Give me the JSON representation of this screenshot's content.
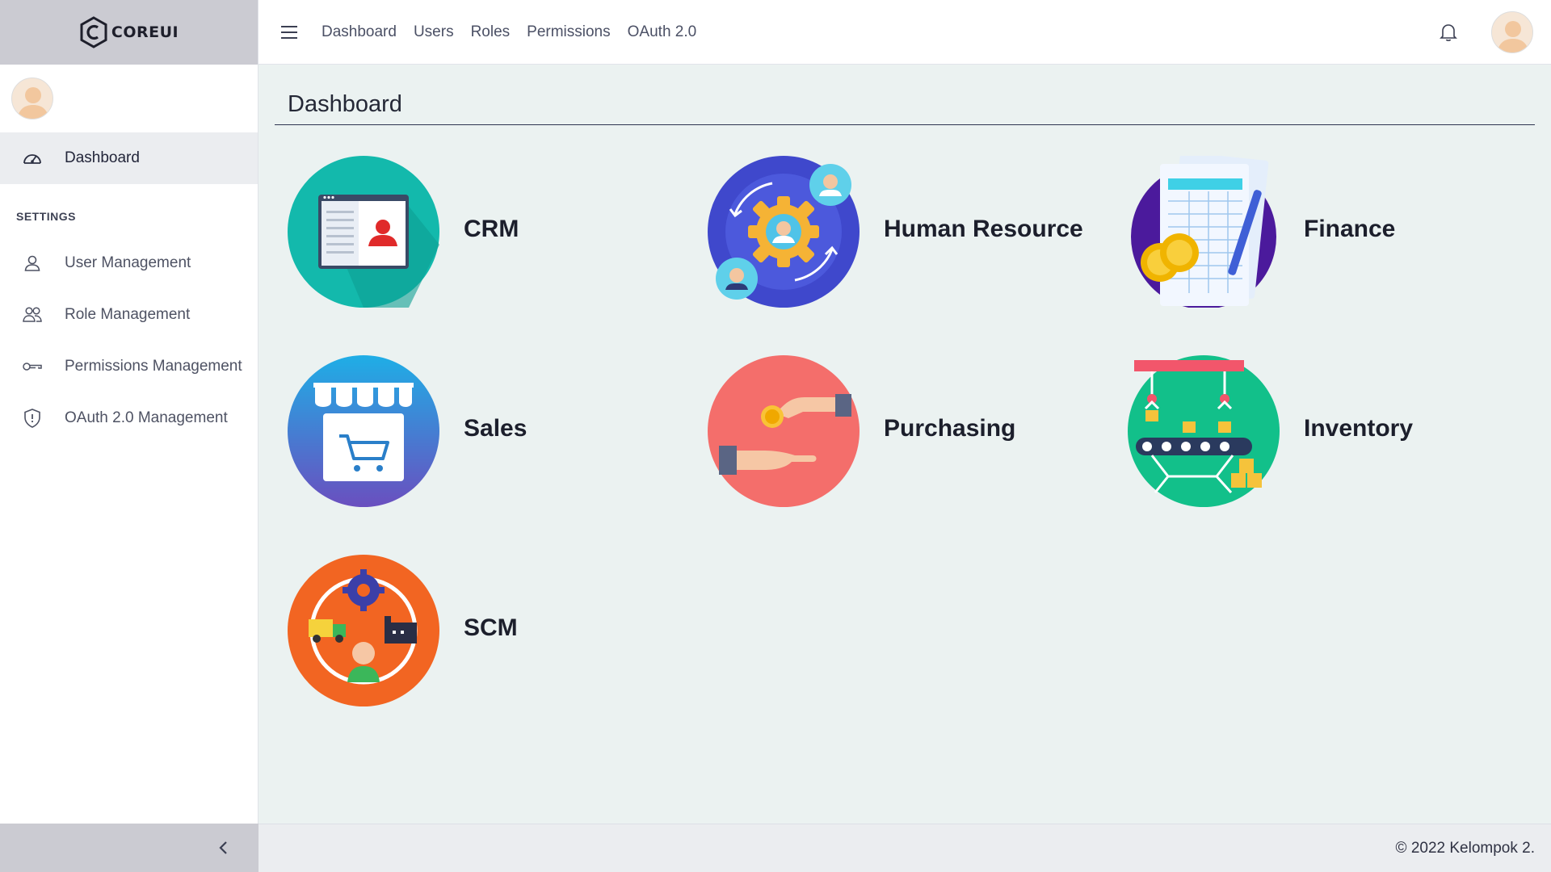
{
  "brand": {
    "name": "COREUI",
    "icon": "coreui-logo-icon"
  },
  "sidebar": {
    "items": [
      {
        "label": "Dashboard",
        "icon": "speedometer-icon",
        "active": true
      }
    ],
    "section_title": "SETTINGS",
    "settings_items": [
      {
        "label": "User Management",
        "icon": "user-icon"
      },
      {
        "label": "Role Management",
        "icon": "people-icon"
      },
      {
        "label": "Permissions Management",
        "icon": "key-icon"
      },
      {
        "label": "OAuth 2.0 Management",
        "icon": "shield-icon"
      }
    ],
    "toggler_icon": "chevron-left-icon"
  },
  "header": {
    "nav": [
      "Dashboard",
      "Users",
      "Roles",
      "Permissions",
      "OAuth 2.0"
    ],
    "icons": [
      "menu-icon",
      "bell-icon",
      "avatar"
    ]
  },
  "main": {
    "title": "Dashboard",
    "modules": [
      {
        "label": "CRM",
        "icon": "crm-icon",
        "color": "#14b8a6"
      },
      {
        "label": "Human Resource",
        "icon": "human-resource-icon",
        "color": "#3f48cc"
      },
      {
        "label": "Finance",
        "icon": "finance-icon",
        "color": "#4b1a9c"
      },
      {
        "label": "Sales",
        "icon": "sales-store-icon",
        "color": "#1e90ff"
      },
      {
        "label": "Purchasing",
        "icon": "purchasing-icon",
        "color": "#f87171"
      },
      {
        "label": "Inventory",
        "icon": "inventory-icon",
        "color": "#10c08a"
      },
      {
        "label": "SCM",
        "icon": "scm-icon",
        "color": "#f26522"
      }
    ]
  },
  "footer": {
    "text": "© 2022 Kelompok 2."
  },
  "colors": {
    "sidebar_brand_bg": "#cbcbd2",
    "content_bg": "#ebf2f1",
    "header_bg": "#ffffff"
  }
}
